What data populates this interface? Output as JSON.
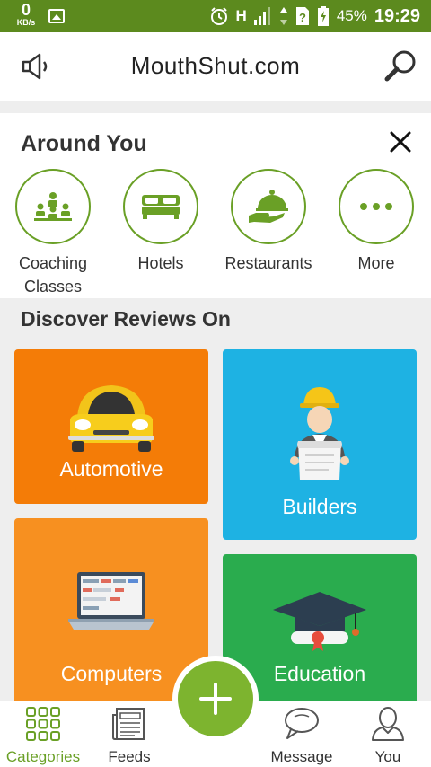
{
  "status_bar": {
    "speed_value": "0",
    "speed_unit": "KB/s",
    "network": "H",
    "battery": "45%",
    "time": "19:29"
  },
  "header": {
    "title": "MouthShut.com"
  },
  "around_you": {
    "heading": "Around You",
    "categories": [
      {
        "label": "Coaching Classes",
        "icon": "coaching-icon"
      },
      {
        "label": "Hotels",
        "icon": "bed-icon"
      },
      {
        "label": "Restaurants",
        "icon": "cloche-icon"
      },
      {
        "label": "More",
        "icon": "more-dots-icon"
      }
    ]
  },
  "discover": {
    "heading": "Discover Reviews On",
    "tiles": [
      {
        "label": "Automotive",
        "color": "#f47c07"
      },
      {
        "label": "Builders",
        "color": "#1eb2e3"
      },
      {
        "label": "Computers",
        "color": "#f79020"
      },
      {
        "label": "Education",
        "color": "#2aac4e"
      }
    ]
  },
  "bottom_nav": {
    "items": [
      {
        "label": "Categories",
        "active": true
      },
      {
        "label": "Feeds",
        "active": false
      },
      {
        "label": "Message",
        "active": false
      },
      {
        "label": "You",
        "active": false
      }
    ]
  },
  "colors": {
    "brand_green": "#6aa026",
    "status_bar": "#5c8a1e",
    "fab": "#7db42f"
  }
}
